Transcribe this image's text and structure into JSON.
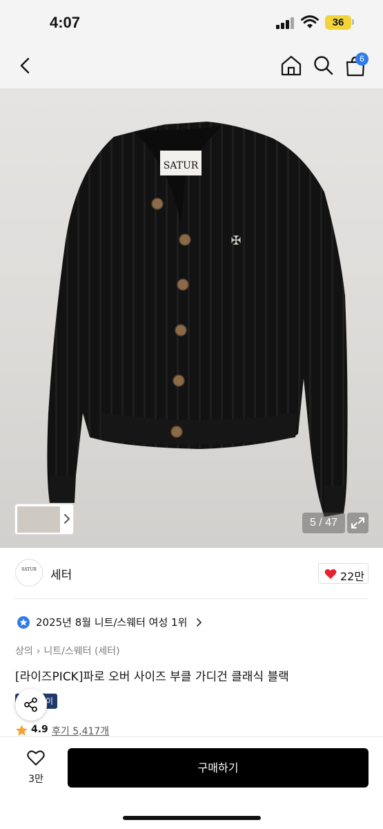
{
  "status_bar": {
    "time": "4:07",
    "battery": "36"
  },
  "nav": {
    "cart_count": "6"
  },
  "product_image": {
    "label_text": "SATUR",
    "counter": "5 / 47"
  },
  "brand": {
    "logo_text": "SATUR",
    "name": "세터",
    "likes": "22만"
  },
  "ranking": {
    "text": "2025년 8월 니트/스웨터 여성 1위"
  },
  "breadcrumb": {
    "items": [
      "상의",
      "니트/스웨터 (세터)"
    ]
  },
  "product": {
    "title": "[라이즈PICK]파로 오버 사이즈 부클 가디건 클래식 블랙",
    "tag": "이",
    "rating": "4.9",
    "reviews": "후기 5,417개"
  },
  "bottom_bar": {
    "wish_count": "3만",
    "buy_label": "구매하기"
  },
  "colors": {
    "accent_blue": "#2f7ce6",
    "heart_red": "#e5212b",
    "star_orange": "#f2a33a",
    "tag_navy": "#1e3a6b"
  }
}
